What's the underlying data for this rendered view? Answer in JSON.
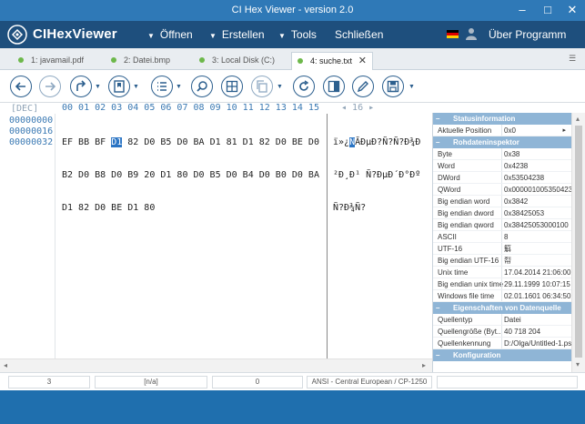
{
  "window": {
    "title": "CI Hex Viewer - version 2.0"
  },
  "menu": {
    "brand": "CIHexViewer",
    "items": [
      "Öffnen",
      "Erstellen",
      "Tools",
      "Schließen"
    ],
    "about": "Über Programm",
    "language": "de"
  },
  "tabs": [
    {
      "label": "1: javamail.pdf",
      "active": false
    },
    {
      "label": "2: Datei.bmp",
      "active": false
    },
    {
      "label": "3: Local Disk (C:)",
      "active": false
    },
    {
      "label": "4: suche.txt",
      "active": true
    }
  ],
  "toolbar": {
    "buttons": [
      "back-icon",
      "forward-icon",
      "redo-icon",
      "bookmark-icon",
      "list-icon",
      "search-icon",
      "grid-icon",
      "copy-icon",
      "refresh-icon",
      "panel-icon",
      "edit-icon",
      "save-icon"
    ]
  },
  "hex": {
    "base": "[DEC]",
    "columns_header": "00 01 02 03 04 05 06 07 08 09 10 11 12 13 14 15",
    "text_header": "16",
    "offsets": [
      "00000000",
      "00000016",
      "00000032"
    ],
    "rows": [
      {
        "before": "EF BB BF ",
        "selected": "D1",
        "after": " 82 D0 B5 D0 BA D1 81 D1 82 D0 BE D0"
      },
      {
        "before": "B2 D0 B8 D0 B9 20 D1 80 D0 B5 D0 B4 D0 B0 D0 BA",
        "selected": "",
        "after": ""
      },
      {
        "before": "D1 82 D0 BE D1 80",
        "selected": "",
        "after": ""
      }
    ],
    "text_rows": [
      {
        "before": "ï»¿",
        "selected": "Ñ",
        "after": "ĂĐμĐ?Ñ?Ñ?Đ¾Đ"
      },
      {
        "before": "²Đ¸Đ¹ Ñ?ĐμĐ´Đ°Đº",
        "selected": "",
        "after": ""
      },
      {
        "before": "Ñ?Đ¾Ñ?",
        "selected": "",
        "after": ""
      }
    ]
  },
  "panel": {
    "status_title": "Statusinformation",
    "status_rows": [
      {
        "key": "Aktuelle Position",
        "value": "0x0"
      }
    ],
    "inspector_title": "Rohdateninspektor",
    "inspector_rows": [
      {
        "key": "Byte",
        "value": "0x38"
      },
      {
        "key": "Word",
        "value": "0x4238"
      },
      {
        "key": "DWord",
        "value": "0x53504238"
      },
      {
        "key": "QWord",
        "value": "0x000001005350423"
      },
      {
        "key": "Big endian word",
        "value": "0x3842"
      },
      {
        "key": "Big endian dword",
        "value": "0x38425053"
      },
      {
        "key": "Big endian qword",
        "value": "0x38425053000100"
      },
      {
        "key": "ASCII",
        "value": "8"
      },
      {
        "key": "UTF-16",
        "value": "䈸"
      },
      {
        "key": "Big endian UTF-16",
        "value": "㡂"
      },
      {
        "key": "Unix time",
        "value": "17.04.2014 21:06:00"
      },
      {
        "key": "Big endian unix time",
        "value": "29.11.1999 10:07:15"
      },
      {
        "key": "Windows file time",
        "value": "02.01.1601 06:34:50"
      }
    ],
    "source_title": "Eigenschaften von Datenquelle",
    "source_rows": [
      {
        "key": "Quellentyp",
        "value": "Datei"
      },
      {
        "key": "Quellengröße (Byt...",
        "value": "40 718 204"
      },
      {
        "key": "Quellenkennung",
        "value": "D:/Olga/Untitled-1.ps"
      }
    ],
    "config_title": "Konfiguration"
  },
  "status": {
    "position": "3",
    "selection": "[n/a]",
    "value": "0",
    "encoding": "ANSI - Central European / CP-1250"
  },
  "colors": {
    "title_bg": "#2f79b7",
    "menu_bg": "#1e4f7d",
    "accent": "#3a79b3",
    "selection": "#2a74c4",
    "section_bg": "#8fb5d6",
    "bottom_bg": "#1f6fae"
  }
}
